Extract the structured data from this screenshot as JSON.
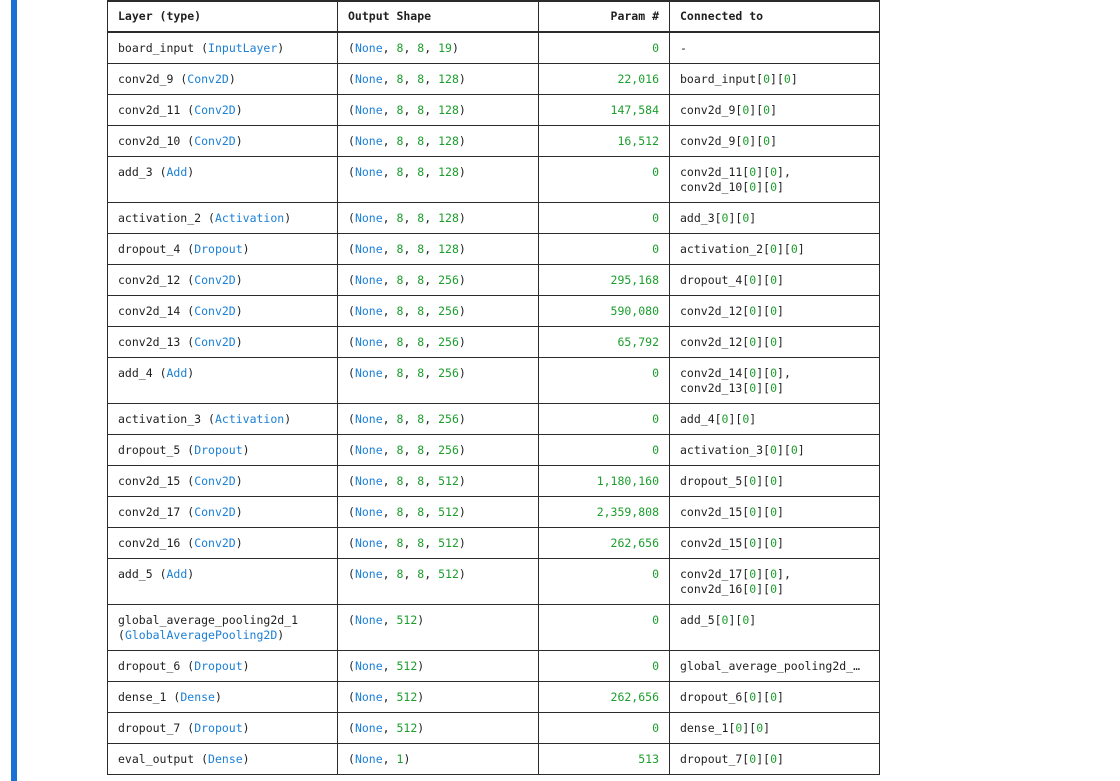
{
  "headers": {
    "layer": "Layer (type)",
    "output": "Output Shape",
    "params": "Param #",
    "connected": "Connected to"
  },
  "rows": [
    {
      "name": "board_input",
      "type": "InputLayer",
      "shape": [
        "None",
        "8",
        "8",
        "19"
      ],
      "params": "0",
      "connected": [
        "-"
      ]
    },
    {
      "name": "conv2d_9",
      "type": "Conv2D",
      "shape": [
        "None",
        "8",
        "8",
        "128"
      ],
      "params": "22,016",
      "connected": [
        "board_input[0][0]"
      ]
    },
    {
      "name": "conv2d_11",
      "type": "Conv2D",
      "shape": [
        "None",
        "8",
        "8",
        "128"
      ],
      "params": "147,584",
      "connected": [
        "conv2d_9[0][0]"
      ]
    },
    {
      "name": "conv2d_10",
      "type": "Conv2D",
      "shape": [
        "None",
        "8",
        "8",
        "128"
      ],
      "params": "16,512",
      "connected": [
        "conv2d_9[0][0]"
      ]
    },
    {
      "name": "add_3",
      "type": "Add",
      "shape": [
        "None",
        "8",
        "8",
        "128"
      ],
      "params": "0",
      "connected": [
        "conv2d_11[0][0],",
        "conv2d_10[0][0]"
      ]
    },
    {
      "name": "activation_2",
      "type": "Activation",
      "shape": [
        "None",
        "8",
        "8",
        "128"
      ],
      "params": "0",
      "connected": [
        "add_3[0][0]"
      ]
    },
    {
      "name": "dropout_4",
      "type": "Dropout",
      "shape": [
        "None",
        "8",
        "8",
        "128"
      ],
      "params": "0",
      "connected": [
        "activation_2[0][0]"
      ]
    },
    {
      "name": "conv2d_12",
      "type": "Conv2D",
      "shape": [
        "None",
        "8",
        "8",
        "256"
      ],
      "params": "295,168",
      "connected": [
        "dropout_4[0][0]"
      ]
    },
    {
      "name": "conv2d_14",
      "type": "Conv2D",
      "shape": [
        "None",
        "8",
        "8",
        "256"
      ],
      "params": "590,080",
      "connected": [
        "conv2d_12[0][0]"
      ]
    },
    {
      "name": "conv2d_13",
      "type": "Conv2D",
      "shape": [
        "None",
        "8",
        "8",
        "256"
      ],
      "params": "65,792",
      "connected": [
        "conv2d_12[0][0]"
      ]
    },
    {
      "name": "add_4",
      "type": "Add",
      "shape": [
        "None",
        "8",
        "8",
        "256"
      ],
      "params": "0",
      "connected": [
        "conv2d_14[0][0],",
        "conv2d_13[0][0]"
      ]
    },
    {
      "name": "activation_3",
      "type": "Activation",
      "shape": [
        "None",
        "8",
        "8",
        "256"
      ],
      "params": "0",
      "connected": [
        "add_4[0][0]"
      ]
    },
    {
      "name": "dropout_5",
      "type": "Dropout",
      "shape": [
        "None",
        "8",
        "8",
        "256"
      ],
      "params": "0",
      "connected": [
        "activation_3[0][0]"
      ]
    },
    {
      "name": "conv2d_15",
      "type": "Conv2D",
      "shape": [
        "None",
        "8",
        "8",
        "512"
      ],
      "params": "1,180,160",
      "connected": [
        "dropout_5[0][0]"
      ]
    },
    {
      "name": "conv2d_17",
      "type": "Conv2D",
      "shape": [
        "None",
        "8",
        "8",
        "512"
      ],
      "params": "2,359,808",
      "connected": [
        "conv2d_15[0][0]"
      ]
    },
    {
      "name": "conv2d_16",
      "type": "Conv2D",
      "shape": [
        "None",
        "8",
        "8",
        "512"
      ],
      "params": "262,656",
      "connected": [
        "conv2d_15[0][0]"
      ]
    },
    {
      "name": "add_5",
      "type": "Add",
      "shape": [
        "None",
        "8",
        "8",
        "512"
      ],
      "params": "0",
      "connected": [
        "conv2d_17[0][0],",
        "conv2d_16[0][0]"
      ]
    },
    {
      "name": "global_average_pooling2d_1",
      "type": "GlobalAveragePooling2D",
      "type_on_new_line": true,
      "shape": [
        "None",
        "512"
      ],
      "params": "0",
      "connected": [
        "add_5[0][0]"
      ]
    },
    {
      "name": "dropout_6",
      "type": "Dropout",
      "shape": [
        "None",
        "512"
      ],
      "params": "0",
      "connected": [
        "global_average_pooling2d_…"
      ]
    },
    {
      "name": "dense_1",
      "type": "Dense",
      "shape": [
        "None",
        "512"
      ],
      "params": "262,656",
      "connected": [
        "dropout_6[0][0]"
      ]
    },
    {
      "name": "dropout_7",
      "type": "Dropout",
      "shape": [
        "None",
        "512"
      ],
      "params": "0",
      "connected": [
        "dense_1[0][0]"
      ]
    },
    {
      "name": "eval_output",
      "type": "Dense",
      "shape": [
        "None",
        "1"
      ],
      "params": "513",
      "connected": [
        "dropout_7[0][0]"
      ]
    }
  ]
}
